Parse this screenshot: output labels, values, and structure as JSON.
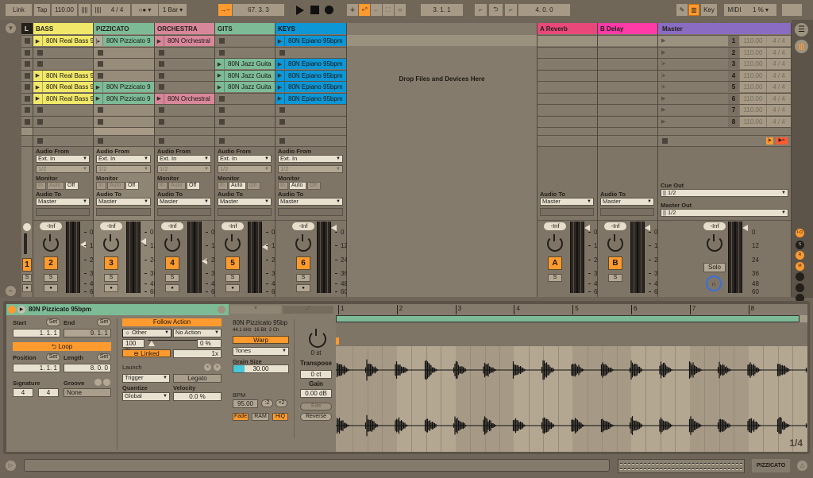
{
  "transport": {
    "link": "Link",
    "tap": "Tap",
    "tempo": "110.00",
    "nudge_down": "||||",
    "nudge_up": "||||",
    "signature": "4 / 4",
    "metronome": "○●",
    "quantize": "1 Bar",
    "position": "67.  3.  3",
    "loop_start": "3.  1.  1",
    "loop_length": "4.  0.  0",
    "key": "Key",
    "midi": "MIDI",
    "cpu": "1 %"
  },
  "colors": {
    "accent": "#ff9a2e",
    "bass": "#f1e86a",
    "pizzicato": "#7dbb97",
    "orchestra": "#d8879a",
    "gits": "#7dbb97",
    "keys": "#0d97d6",
    "reverb": "#e8497a",
    "delay": "#ff3ba8",
    "master": "#8a6cc2"
  },
  "session": {
    "drop_hint": "Drop Files and Devices Here",
    "scene_header": "L",
    "tracks": [
      {
        "name": "BASS",
        "color": "#f1e86a",
        "number": "2",
        "clips": [
          "80N Real Bass 9",
          "",
          "",
          "80N Real Bass 9",
          "80N Real Bass 9",
          "80N Real Bass 9",
          "",
          ""
        ],
        "monitor": "Off"
      },
      {
        "name": "PIZZICATO",
        "color": "#7dbb97",
        "number": "3",
        "clips": [
          "80N Pizzicato 9",
          "",
          "",
          "",
          "80N Pizzicato 9",
          "80N Pizzicato 9",
          "",
          ""
        ],
        "monitor": "Off",
        "playing": 0
      },
      {
        "name": "ORCHESTRA",
        "color": "#d8879a",
        "number": "4",
        "clips": [
          "80N Orchestral",
          "",
          "",
          "",
          "",
          "80N Orchestral",
          "",
          ""
        ],
        "monitor": "Off"
      },
      {
        "name": "GITS",
        "color": "#7dbb97",
        "number": "5",
        "clips": [
          "",
          "",
          "80N Jazz Guita",
          "80N Jazz Guita",
          "80N Jazz Guita",
          "",
          "",
          ""
        ],
        "monitor": "Auto"
      },
      {
        "name": "KEYS",
        "color": "#0d97d6",
        "number": "6",
        "clips": [
          "80N Epiano 95bpm",
          "",
          "80N Epiano 95bpm",
          "80N Epiano 95bpm",
          "80N Epiano 95bpm",
          "80N Epiano 95bpm",
          "",
          ""
        ],
        "monitor": "Auto"
      }
    ],
    "io": {
      "audio_from": "Audio From",
      "input": "Ext. In",
      "channel": "1/2",
      "monitor": "Monitor",
      "monitor_in": "In",
      "monitor_auto": "Auto",
      "monitor_off": "Off",
      "audio_to": "Audio To",
      "output": "Master"
    },
    "returns": [
      {
        "name": "A Reverb",
        "color": "#e8497a",
        "letter": "A"
      },
      {
        "name": "B Delay",
        "color": "#ff3ba8",
        "letter": "B"
      }
    ],
    "master": {
      "name": "Master",
      "cue_out": "Cue Out",
      "cue_value": "1/2",
      "master_out": "Master Out",
      "master_value": "1/2",
      "solo": "Solo",
      "scenes": [
        {
          "n": "1",
          "tempo": "110.00",
          "sig": "4 / 4"
        },
        {
          "n": "2",
          "tempo": "110.00",
          "sig": "4 / 4"
        },
        {
          "n": "3",
          "tempo": "110.00",
          "sig": "4 / 4"
        },
        {
          "n": "4",
          "tempo": "110.00",
          "sig": "4 / 4"
        },
        {
          "n": "5",
          "tempo": "110.00",
          "sig": "4 / 4"
        },
        {
          "n": "6",
          "tempo": "110.00",
          "sig": "4 / 4"
        },
        {
          "n": "7",
          "tempo": "110.00",
          "sig": "4 / 4"
        },
        {
          "n": "8",
          "tempo": "110.00",
          "sig": "4 / 4"
        }
      ]
    },
    "volume": "-Inf",
    "solo": "S",
    "track1_number": "1",
    "scale": [
      "0",
      "12",
      "24",
      "36",
      "48",
      "60"
    ]
  },
  "sidebar": [
    "I-O",
    "S",
    "R",
    "M"
  ],
  "clip": {
    "name": "80N Pizzicato 95bpm",
    "start": "Start",
    "end": "End",
    "set": "Set",
    "start_value": "1.   1.   1",
    "end_value": "9.   1.   1",
    "loop": "Loop",
    "position": "Position",
    "length": "Length",
    "position_value": "1.   1.   1",
    "length_value": "8.   0.   0",
    "signature": "Signature",
    "sig_num": "4",
    "sig_den": "4",
    "groove": "Groove",
    "groove_value": "None",
    "follow_action": "Follow Action",
    "fa_a": "Other",
    "fa_b": "No Action",
    "chance_a": "100 %",
    "chance_b": "0 %",
    "linked": "Linked",
    "multiplier": "1x",
    "launch": "Launch",
    "launch_mode": "Trigger",
    "legato": "Legato",
    "quantize": "Quantize",
    "quantize_value": "Global",
    "velocity": "Velocity",
    "velocity_value": "0.0 %"
  },
  "sample": {
    "name": "80N Pizzicato 95bp",
    "rate": "44.1 kHz",
    "bits": "16 Bit",
    "channels": "2 Ch",
    "warp": "Warp",
    "mode": "Tones",
    "grain_label": "Grain Size",
    "grain": "30.00",
    "grain_fraction": 0.2,
    "bpm_label": "BPM",
    "bpm": "95.00",
    "half": ":2",
    "double": "×2",
    "fade": "Fade",
    "ram": "RAM",
    "hiq": "HiQ",
    "transpose": "0 st",
    "transpose_label": "Transpose",
    "detune": "0 ct",
    "gain_label": "Gain",
    "gain": "0.00 dB",
    "edit": "Edit",
    "reverse": "Reverse"
  },
  "waveform": {
    "bars": [
      "1",
      "2",
      "3",
      "4",
      "5",
      "6",
      "7",
      "8"
    ],
    "page": "1/4"
  },
  "status": {
    "selected_track": "PIZZICATO"
  }
}
